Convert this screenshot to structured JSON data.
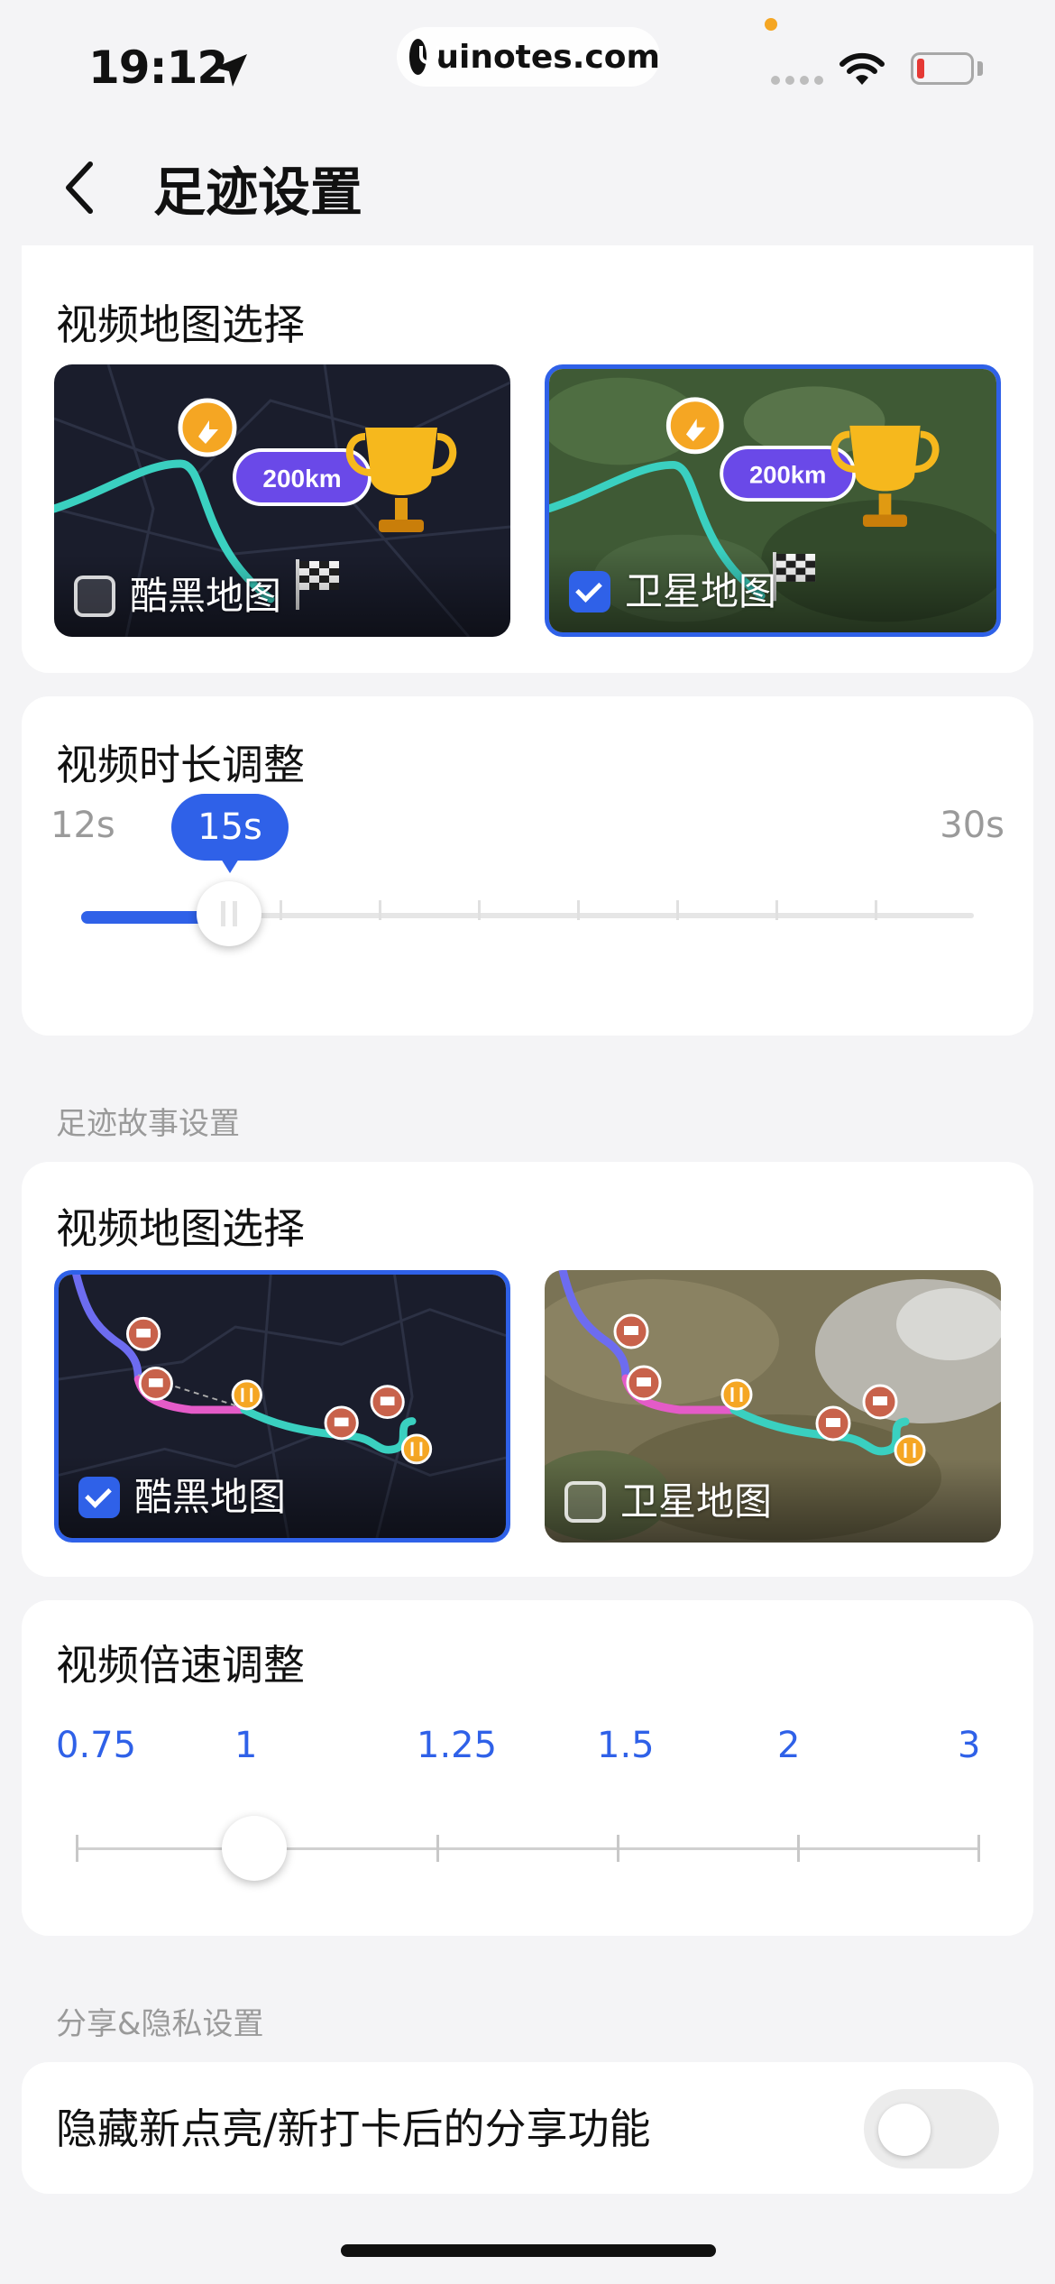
{
  "status_bar": {
    "time": "19:12",
    "watermark": "uinotes.com"
  },
  "header": {
    "title": "足迹设置"
  },
  "video_map_1": {
    "title": "视频地图选择",
    "options": [
      {
        "label": "酷黑地图",
        "badge": "200km",
        "selected": false
      },
      {
        "label": "卫星地图",
        "badge": "200km",
        "selected": true
      }
    ]
  },
  "duration": {
    "title": "视频时长调整",
    "min_label": "12s",
    "max_label": "30s",
    "value_label": "15s",
    "value": 15,
    "min": 12,
    "max": 30
  },
  "story_section": {
    "label": "足迹故事设置"
  },
  "video_map_2": {
    "title": "视频地图选择",
    "options": [
      {
        "label": "酷黑地图",
        "selected": true
      },
      {
        "label": "卫星地图",
        "selected": false
      }
    ]
  },
  "speed": {
    "title": "视频倍速调整",
    "options": [
      "0.75",
      "1",
      "1.25",
      "1.5",
      "2",
      "3"
    ],
    "selected": "1"
  },
  "share_section": {
    "label": "分享&隐私设置"
  },
  "privacy": {
    "label": "隐藏新点亮/新打卡后的分享功能",
    "enabled": false
  },
  "colors": {
    "accent": "#2f61e8",
    "route_teal": "#3ad0c0",
    "route_pink": "#e45bc8",
    "marker_orange": "#f5a623"
  },
  "icons": [
    "location-arrow-icon",
    "wifi-icon",
    "battery-icon",
    "back-chevron-icon",
    "trophy-icon",
    "finish-flag-icon",
    "turn-marker-icon",
    "gas-station-icon",
    "food-icon"
  ]
}
